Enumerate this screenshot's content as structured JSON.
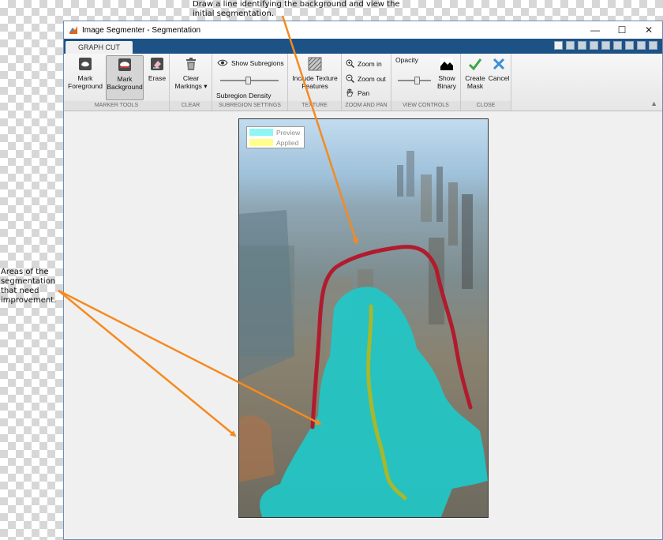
{
  "annotations": {
    "top": "Draw a line identifying the background and view the\ninitial segmentation.",
    "left": "Areas of the\nsegmentation\nthat need\nimprovement."
  },
  "window": {
    "title": "Image Segmenter - Segmentation",
    "minimize": "—",
    "maximize": "☐",
    "close": "✕"
  },
  "tabs": [
    {
      "label": "GRAPH CUT"
    }
  ],
  "ribbon": {
    "marker_tools": {
      "label": "MARKER TOOLS",
      "mark_foreground": "Mark\nForeground",
      "mark_background": "Mark\nBackground",
      "erase": "Erase"
    },
    "clear": {
      "label": "CLEAR",
      "clear_markings": "Clear\nMarkings ▾"
    },
    "subregion": {
      "label": "SUBREGION SETTINGS",
      "show_subregions": "Show Subregions",
      "density": "Subregion Density",
      "density_level": 0.48
    },
    "texture": {
      "label": "TEXTURE",
      "include": "Include Texture\nFeatures"
    },
    "zoom_pan": {
      "label": "ZOOM AND PAN",
      "zoom_in": "Zoom in",
      "zoom_out": "Zoom out",
      "pan": "Pan"
    },
    "view_controls": {
      "label": "VIEW CONTROLS",
      "opacity": "Opacity",
      "opacity_level": 0.6,
      "show_binary": "Show\nBinary"
    },
    "close": {
      "label": "CLOSE",
      "create_mask": "Create\nMask",
      "cancel": "Cancel"
    }
  },
  "legend": {
    "preview": "Preview",
    "applied": "Applied",
    "preview_color": "#8ff6f6",
    "applied_color": "#ffff8e"
  },
  "colors": {
    "foreground_mask": "#1fc8c8",
    "background_marker": "#b01c2e",
    "foreground_marker": "#a6b82c",
    "callout_arrow": "#f58a1f"
  }
}
